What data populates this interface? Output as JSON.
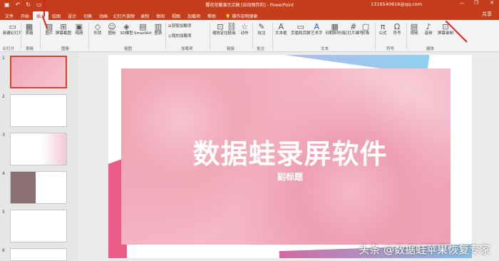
{
  "titlebar": {
    "document": "樱花花瓣演示文稿 [自动保存的] - PowerPoint",
    "account": "1316540616@qq.com",
    "minimize": "—",
    "restore": "❐",
    "close": "✕"
  },
  "tabs": [
    "文件",
    "开始",
    "插入",
    "绘图",
    "设计",
    "切换",
    "动画",
    "幻灯片放映",
    "录制",
    "审阅",
    "视图",
    "加载项",
    "帮助"
  ],
  "active_tab": "插入",
  "search": "操作说明搜索",
  "share": "共享",
  "ribbon": {
    "buttons": [
      "新建幻灯片",
      "表格",
      "图片",
      "屏幕截图",
      "相册",
      "形状",
      "图标",
      "3D模型",
      "SmartArt",
      "图表",
      "获取加载项",
      "我的加载项",
      "缩放定位",
      "链接",
      "动作",
      "批注",
      "文本框",
      "页眉和页脚",
      "艺术字",
      "日期和时间",
      "幻灯片编号",
      "对象",
      "公式",
      "符号",
      "视频",
      "音频",
      "屏幕录制"
    ],
    "groups": [
      "幻灯片",
      "表格",
      "图像",
      "插图",
      "加载项",
      "链接",
      "批注",
      "文本",
      "符号",
      "媒体"
    ]
  },
  "thumbnails": [
    "1",
    "2",
    "3",
    "4",
    "5",
    "6"
  ],
  "slide": {
    "title": "数据蛙录屏软件",
    "subtitle": "副标题"
  },
  "watermark": "头条 @数据蛙苹果恢复专家",
  "colors": {
    "accent": "#c43e1c",
    "arrow": "#e02020"
  }
}
